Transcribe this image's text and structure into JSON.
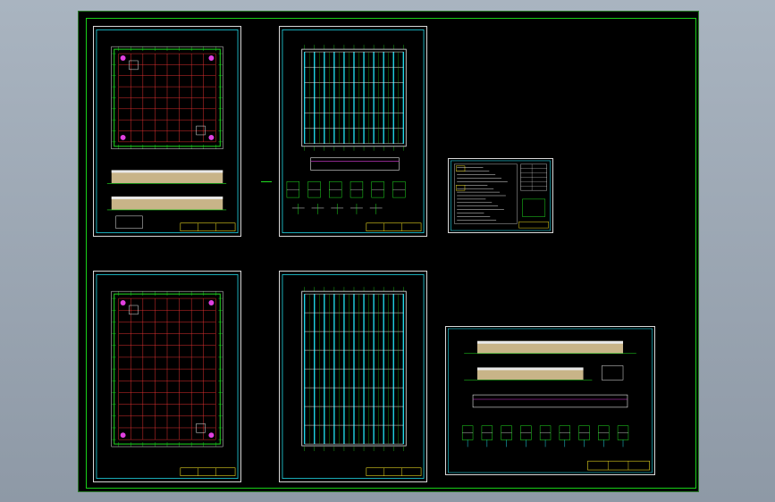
{
  "colors": {
    "background": "#000000",
    "grid_red": "#e03030",
    "line_green": "#20e020",
    "line_cyan": "#20d8e8",
    "line_white": "#e8e8e8",
    "tan": "#c8b488",
    "magenta": "#e040e0",
    "yellow": "#e8d820"
  },
  "sheets": [
    {
      "id": "plan-1",
      "kind": "floor-plan"
    },
    {
      "id": "roof-1",
      "kind": "roof-plan"
    },
    {
      "id": "notes",
      "kind": "notes-table"
    },
    {
      "id": "plan-2",
      "kind": "floor-plan"
    },
    {
      "id": "roof-2",
      "kind": "roof-plan"
    },
    {
      "id": "elevations",
      "kind": "elevations"
    }
  ]
}
